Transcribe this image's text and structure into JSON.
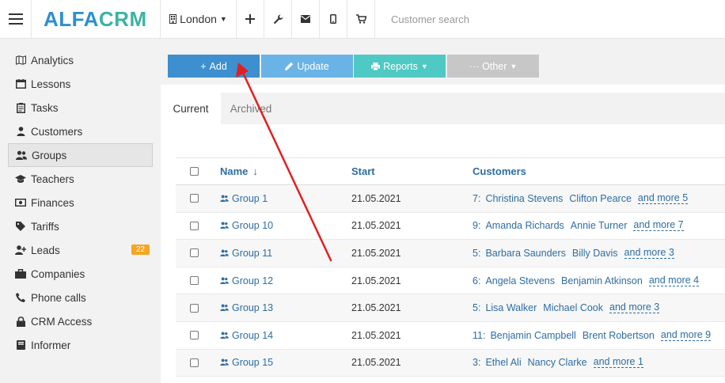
{
  "header": {
    "logo_part1": "ALFA",
    "logo_part2": "CRM",
    "city": "London",
    "search_placeholder": "Customer search"
  },
  "sidebar": {
    "items": [
      {
        "label": "Analytics",
        "icon": "analytics-icon"
      },
      {
        "label": "Lessons",
        "icon": "calendar-icon"
      },
      {
        "label": "Tasks",
        "icon": "clipboard-icon"
      },
      {
        "label": "Customers",
        "icon": "user-icon"
      },
      {
        "label": "Groups",
        "icon": "users-icon"
      },
      {
        "label": "Teachers",
        "icon": "graduation-cap-icon"
      },
      {
        "label": "Finances",
        "icon": "money-icon"
      },
      {
        "label": "Tariffs",
        "icon": "tag-icon"
      },
      {
        "label": "Leads",
        "icon": "user-plus-icon"
      },
      {
        "label": "Companies",
        "icon": "briefcase-icon"
      },
      {
        "label": "Phone calls",
        "icon": "phone-icon"
      },
      {
        "label": "CRM Access",
        "icon": "lock-icon"
      },
      {
        "label": "Informer",
        "icon": "book-icon"
      }
    ],
    "active_item": "Groups",
    "leads_badge": "22"
  },
  "toolbar": {
    "add_label": "Add",
    "update_label": "Update",
    "reports_label": "Reports",
    "other_label": "Other"
  },
  "tabs": [
    {
      "label": "Current",
      "active": true
    },
    {
      "label": "Archived",
      "active": false
    }
  ],
  "table": {
    "headers": {
      "name": "Name",
      "start": "Start",
      "customers": "Customers"
    },
    "sort_indicator": "↓",
    "rows": [
      {
        "name": "Group 1",
        "start": "21.05.2021",
        "count": "7:",
        "customers": [
          "Christina Stevens",
          "Clifton Pearce"
        ],
        "more": "and more 5"
      },
      {
        "name": "Group 10",
        "start": "21.05.2021",
        "count": "9:",
        "customers": [
          "Amanda Richards",
          "Annie Turner"
        ],
        "more": "and more 7"
      },
      {
        "name": "Group 11",
        "start": "21.05.2021",
        "count": "5:",
        "customers": [
          "Barbara Saunders",
          "Billy Davis"
        ],
        "more": "and more 3"
      },
      {
        "name": "Group 12",
        "start": "21.05.2021",
        "count": "6:",
        "customers": [
          "Angela Stevens",
          "Benjamin Atkinson"
        ],
        "more": "and more 4"
      },
      {
        "name": "Group 13",
        "start": "21.05.2021",
        "count": "5:",
        "customers": [
          "Lisa Walker",
          "Michael Cook"
        ],
        "more": "and more 3"
      },
      {
        "name": "Group 14",
        "start": "21.05.2021",
        "count": "11:",
        "customers": [
          "Benjamin Campbell",
          "Brent Robertson"
        ],
        "more": "and more 9"
      },
      {
        "name": "Group 15",
        "start": "21.05.2021",
        "count": "3:",
        "customers": [
          "Ethel Ali",
          "Nancy Clarke"
        ],
        "more": "and more 1"
      }
    ]
  },
  "colors": {
    "brand_blue": "#2e8fd0",
    "brand_teal": "#3bb3a3",
    "add_button": "#3d8fcf",
    "update_button": "#6ab3e6",
    "reports_button": "#4fc9c3",
    "other_button": "#c7c7c7",
    "badge": "#f5a623",
    "annotation_arrow": "#e02020"
  }
}
